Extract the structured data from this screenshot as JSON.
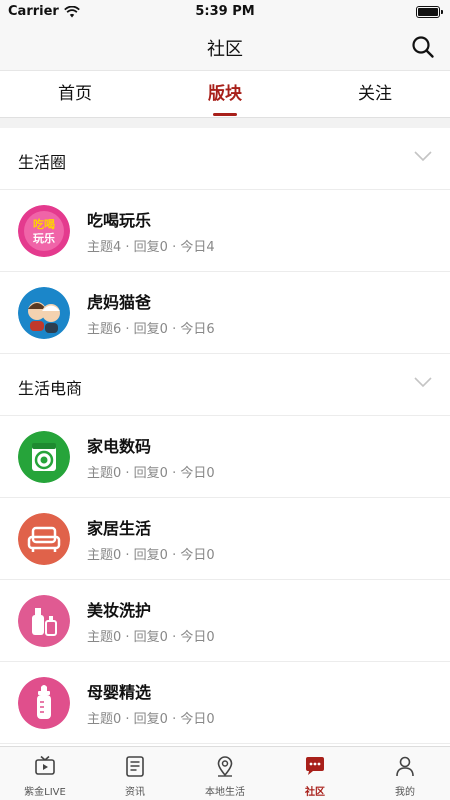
{
  "status_bar": {
    "carrier": "Carrier",
    "time": "5:39 PM"
  },
  "nav": {
    "title": "社区",
    "search_icon": "search-icon"
  },
  "tabs": [
    {
      "label": "首页",
      "active": false
    },
    {
      "label": "版块",
      "active": true
    },
    {
      "label": "关注",
      "active": false
    }
  ],
  "sections": [
    {
      "title": "生活圈",
      "forums": [
        {
          "name": "吃喝玩乐",
          "stats": "主题4 · 回复0 · 今日4",
          "icon": "food-fun-icon"
        },
        {
          "name": "虎妈猫爸",
          "stats": "主题6 · 回复0 · 今日6",
          "icon": "parents-icon"
        }
      ]
    },
    {
      "title": "生活电商",
      "forums": [
        {
          "name": "家电数码",
          "stats": "主题0 · 回复0 · 今日0",
          "icon": "washing-machine-icon"
        },
        {
          "name": "家居生活",
          "stats": "主题0 · 回复0 · 今日0",
          "icon": "sofa-icon"
        },
        {
          "name": "美妆洗护",
          "stats": "主题0 · 回复0 · 今日0",
          "icon": "cosmetics-icon"
        },
        {
          "name": "母婴精选",
          "stats": "主题0 · 回复0 · 今日0",
          "icon": "baby-bottle-icon"
        }
      ]
    }
  ],
  "tabbar": [
    {
      "label": "紫金LIVE",
      "icon": "tv-icon",
      "active": false
    },
    {
      "label": "资讯",
      "icon": "news-icon",
      "active": false
    },
    {
      "label": "本地生活",
      "icon": "location-pin-icon",
      "active": false
    },
    {
      "label": "社区",
      "icon": "chat-bubble-icon",
      "active": true
    },
    {
      "label": "我的",
      "icon": "profile-icon",
      "active": false
    }
  ],
  "colors": {
    "accent": "#a8201a",
    "muted_text": "#888888"
  }
}
